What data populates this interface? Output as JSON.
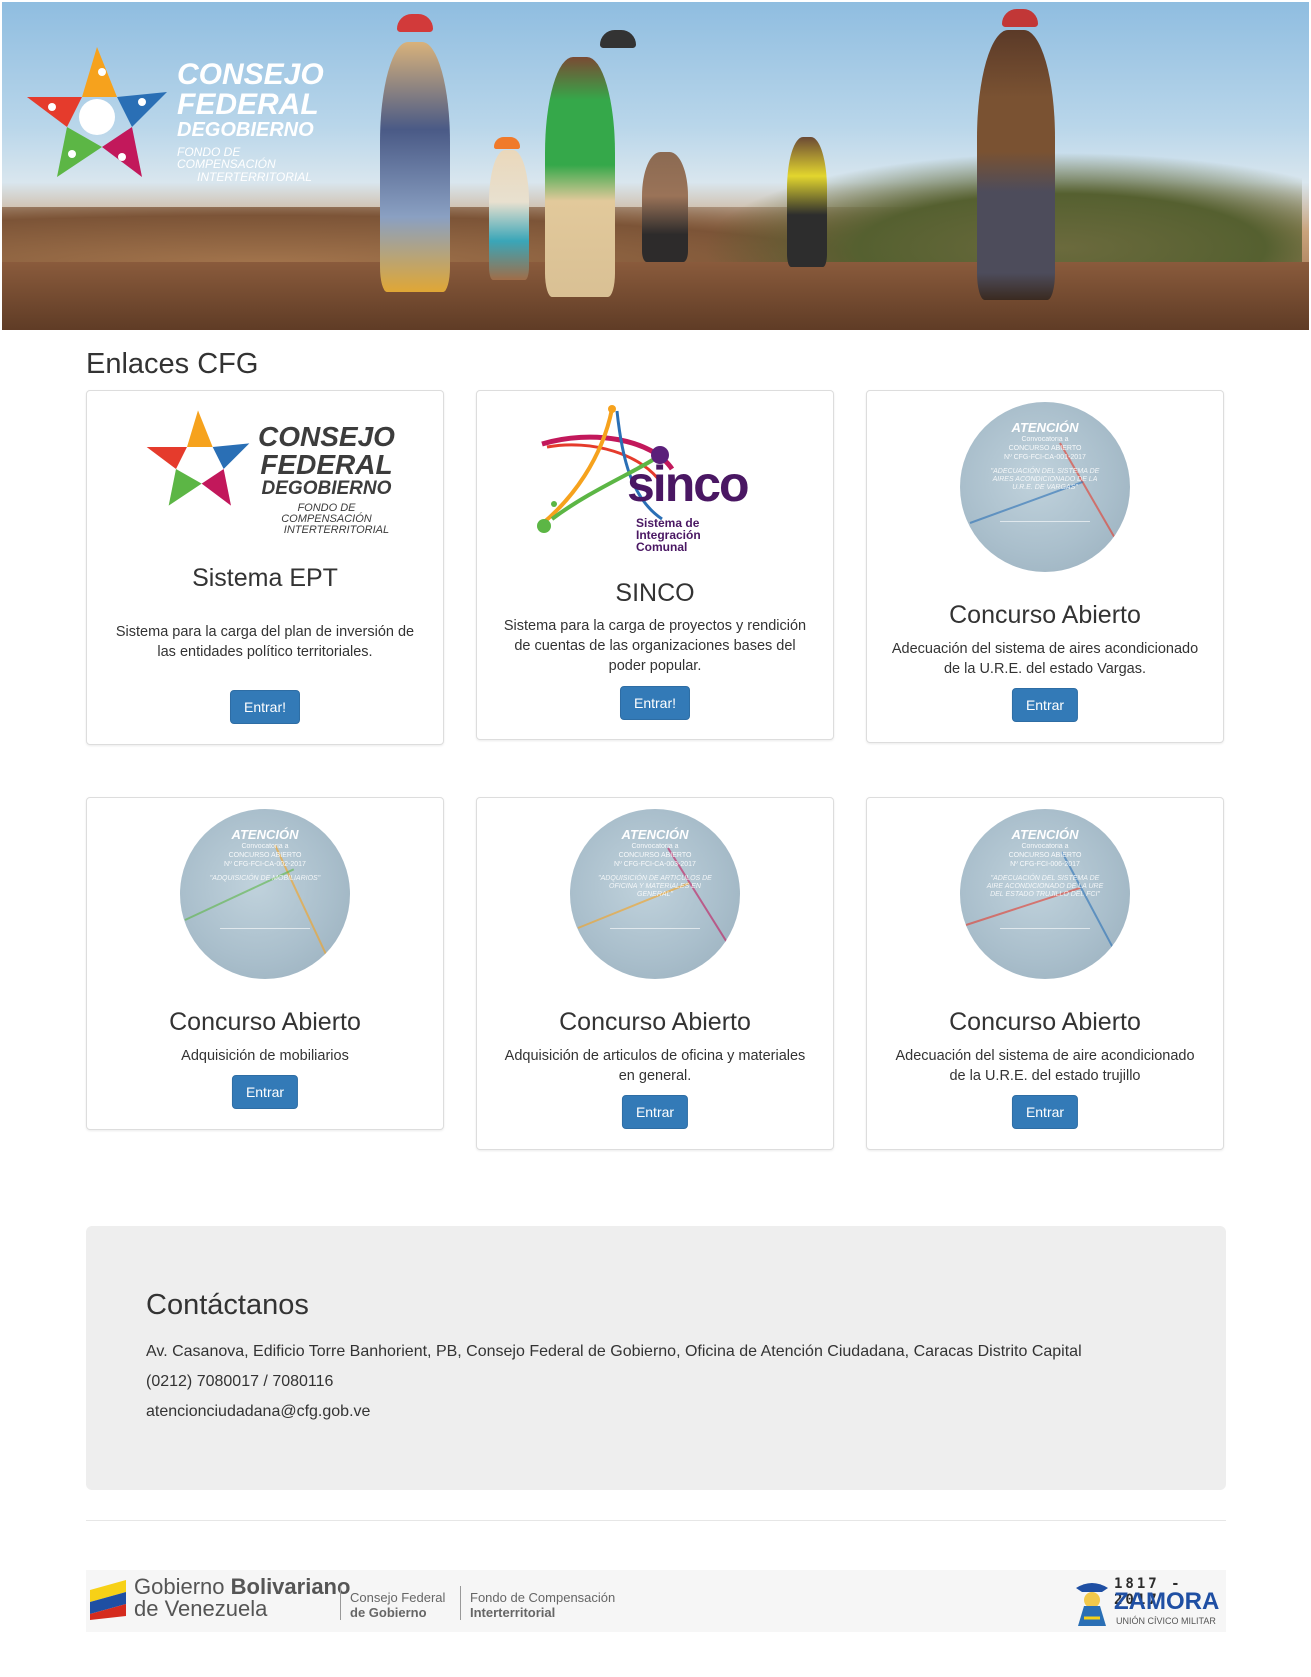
{
  "banner": {
    "brand_line1": "CONSEJO",
    "brand_line2": "FEDERAL",
    "brand_line3": "DEGOBIERNO",
    "brand_line4": "FONDO DE COMPENSACIÓN",
    "brand_line5": "INTERTERRITORIAL"
  },
  "section": {
    "title": "Enlaces CFG"
  },
  "cards": [
    {
      "title": "Sistema EPT",
      "description": "Sistema para la carga del plan de inversión de las entidades político territoriales.",
      "button": "Entrar!"
    },
    {
      "title": "SINCO",
      "description": "Sistema para la carga de proyectos y rendición de cuentas de las organizaciones bases del poder popular.",
      "button": "Entrar!"
    },
    {
      "title": "Concurso Abierto",
      "description": "Adecuación del sistema de aires acondicionado de la U.R.E. del estado Vargas.",
      "button": "Entrar"
    },
    {
      "title": "Concurso Abierto",
      "description": "Adquisición de mobiliarios",
      "button": "Entrar"
    },
    {
      "title": "Concurso Abierto",
      "description": "Adquisición de articulos de oficina y materiales en general.",
      "button": "Entrar"
    },
    {
      "title": "Concurso Abierto",
      "description": "Adecuación del sistema de aire acondicionado de la U.R.E. del estado trujillo",
      "button": "Entrar"
    }
  ],
  "logos": {
    "cfg_line1": "CONSEJO",
    "cfg_line2": "FEDERAL",
    "cfg_line3": "DEGOBIERNO",
    "cfg_line4": "FONDO DE COMPENSACIÓN",
    "cfg_line5": "INTERTERRITORIAL",
    "sinco_word": "sinco",
    "sinco_sub1": "Sistema de",
    "sinco_sub2": "Integración",
    "sinco_sub3": "Comunal"
  },
  "thumbs": [
    {
      "heading": "ATENCIÓN",
      "sub1": "Convocatoria a",
      "sub2": "CONCURSO ABIERTO",
      "code": "Nº CFG-FCI-CA-001-2017",
      "body": "\"ADECUACIÓN DEL SISTEMA DE AIRES ACONDICIONADO DE LA U.R.E. DE VARGAS\""
    },
    {
      "heading": "ATENCIÓN",
      "sub1": "Convocatoria a",
      "sub2": "CONCURSO ABIERTO",
      "code": "Nº CFG-FCI-CA-002-2017",
      "body": "\"ADQUISICIÓN DE MOBILIARIOS\""
    },
    {
      "heading": "ATENCIÓN",
      "sub1": "Convocatoria a",
      "sub2": "CONCURSO ABIERTO",
      "code": "Nº CFG-FCI-CA-003-2017",
      "body": "\"ADQUISICIÓN DE ARTICULOS DE OFICINA Y MATERIALES EN GENERAL\""
    },
    {
      "heading": "ATENCIÓN",
      "sub1": "Convocatoria a",
      "sub2": "CONCURSO ABIERTO",
      "code": "Nº CFG-FCI-006-2017",
      "body": "\"ADECUACIÓN DEL SISTEMA DE AIRE ACONDICIONADO DE LA URE DEL ESTADO TRUJILLO DEL FCI\""
    }
  ],
  "contact": {
    "title": "Contáctanos",
    "address": "Av. Casanova, Edificio Torre Banhorient, PB, Consejo Federal de Gobierno, Oficina de Atención Ciudadana, Caracas Distrito Capital",
    "phone": "(0212) 7080017 / 7080116",
    "email": "atencionciudadana@cfg.gob.ve"
  },
  "footer": {
    "gov_line1_a": "Gobierno ",
    "gov_line1_b": "Bolivariano",
    "gov_line2": "de Venezuela",
    "cfg_l1": "Consejo Federal",
    "cfg_l2": "de Gobierno",
    "fci_l1": "Fondo de Compensación",
    "fci_l2": "Interterritorial",
    "zamora_years": "1817 - 2017",
    "zamora_name": "ZAMORA",
    "zamora_sub": "UNIÓN CÍVICO MILITAR"
  },
  "colors": {
    "button": "#337ab7",
    "contact_bg": "#eeeeee",
    "star_red": "#e53b2c",
    "star_orange": "#f6a21d",
    "star_blue": "#2a6fb5",
    "star_green": "#5cb645",
    "star_magenta": "#c2185b"
  }
}
